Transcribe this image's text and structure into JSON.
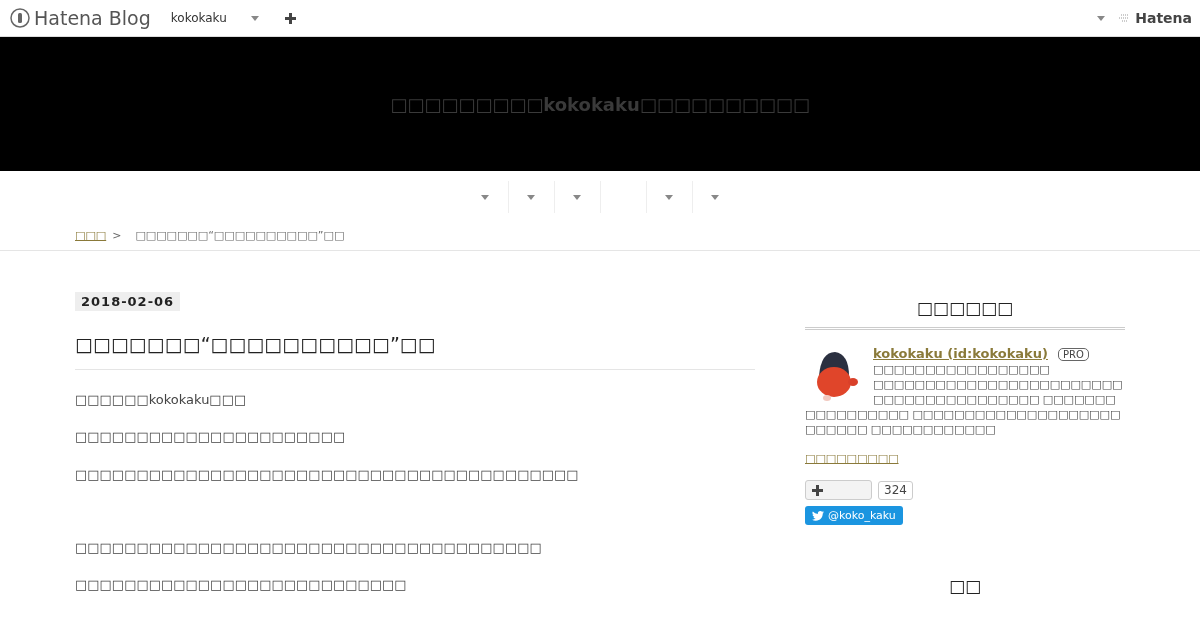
{
  "topbar": {
    "logo": "Hatena Blog",
    "blog_name": "kokokaku",
    "brand": "Hatena"
  },
  "header": {
    "title": "□□□□□□□□□kokokaku□□□□□□□□□□"
  },
  "nav": [
    {
      "kind": "dropdown"
    },
    {
      "kind": "dropdown"
    },
    {
      "kind": "dropdown"
    },
    {
      "kind": "plain"
    },
    {
      "kind": "dropdown"
    },
    {
      "kind": "dropdown"
    }
  ],
  "breadcrumb": {
    "home": "□□□",
    "separator": ">",
    "current": "□□□□□□□“□□□□□□□□□□”□□"
  },
  "entry": {
    "date": "2018-02-06",
    "title": "□□□□□□□“□□□□□□□□□□”□□",
    "sections": [
      [
        "□□□□□□kokokaku□□□",
        "□□□□□□□□□□□□□□□□□□□□□□",
        "□□□□□□□□□□□□□□□□□□□□□□□□□□□□□□□□□□□□□□□□□"
      ],
      [
        "□□□□□□□□□□□□□□□□□□□□□□□□□□□□□□□□□□□□□□",
        "□□□□□□□□□□□□□□□□□□□□□□□□□□□"
      ]
    ]
  },
  "sidebar": {
    "profile_heading": "□□□□□□",
    "name": "kokokaku (id:kokokaku)",
    "badge": "PRO",
    "description": [
      "□□□□□□□□□□□□□□□□□",
      "□□□□□□□□□□□□□□□□□□□□□□□□□□□□□□□□□□□□□□□□ □□□□□□□□□□□□□□□□□ □□□□□□□□□□□□□□□□□□□□□□□□□□ □□□□□□□□□□□□"
    ],
    "about_link": "□□□□□□□□□",
    "follow_count": "324",
    "twitter": "@koko_kaku",
    "next_heading": "□□"
  }
}
